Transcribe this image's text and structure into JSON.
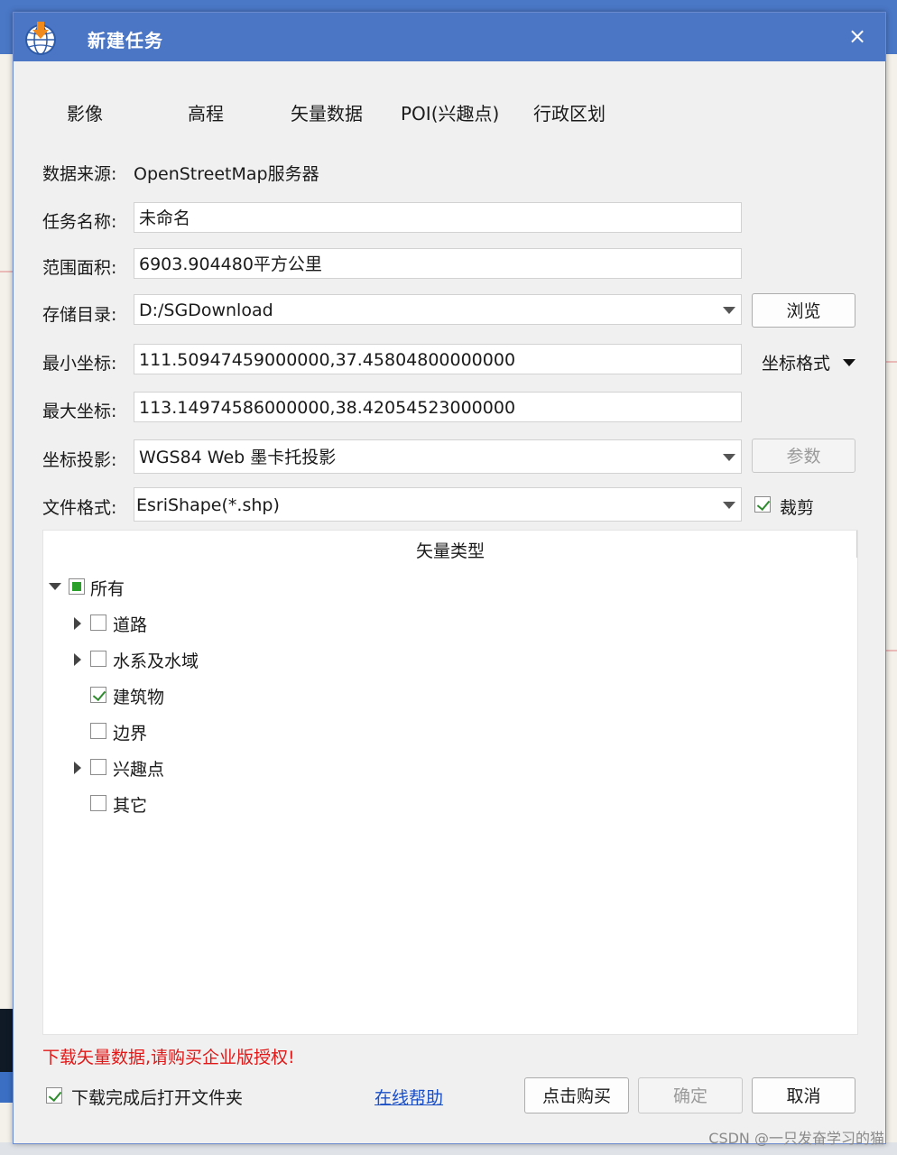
{
  "window": {
    "title": "新建任务",
    "close_label": "×"
  },
  "tabs": [
    "影像",
    "高程",
    "矢量数据",
    "POI(兴趣点)",
    "行政区划"
  ],
  "form": {
    "data_source_label": "数据来源:",
    "data_source_value": "OpenStreetMap服务器",
    "task_name_label": "任务名称:",
    "task_name_value": "未命名",
    "area_label": "范围面积:",
    "area_value": "6903.904480平方公里",
    "storage_label": "存储目录:",
    "storage_value": "D:/SGDownload",
    "browse_label": "浏览",
    "min_coord_label": "最小坐标:",
    "min_coord_value": "111.50947459000000,37.45804800000000",
    "coord_format_label": "坐标格式",
    "max_coord_label": "最大坐标:",
    "max_coord_value": "113.14974586000000,38.42054523000000",
    "projection_label": "坐标投影:",
    "projection_value": "WGS84 Web 墨卡托投影",
    "params_label": "参数",
    "file_format_label": "文件格式:",
    "file_format_value": "EsriShape(*.shp)",
    "clip_label": "裁剪",
    "clip_checked": true
  },
  "tree": {
    "header": "矢量类型",
    "root": {
      "label": "所有",
      "state": "partial",
      "expanded": true
    },
    "children": [
      {
        "label": "道路",
        "checked": false,
        "expandable": true
      },
      {
        "label": "水系及水域",
        "checked": false,
        "expandable": true
      },
      {
        "label": "建筑物",
        "checked": true,
        "expandable": false
      },
      {
        "label": "边界",
        "checked": false,
        "expandable": false
      },
      {
        "label": "兴趣点",
        "checked": false,
        "expandable": true
      },
      {
        "label": "其它",
        "checked": false,
        "expandable": false
      }
    ]
  },
  "footer": {
    "warning": "下载矢量数据,请购买企业版授权!",
    "open_folder_label": "下载完成后打开文件夹",
    "open_folder_checked": true,
    "help_link": "在线帮助",
    "buy_label": "点击购买",
    "ok_label": "确定",
    "cancel_label": "取消"
  },
  "watermark": "CSDN @一只发奋学习的猫",
  "colors": {
    "titlebar": "#4a76c5",
    "warning": "#e01818",
    "link": "#1b4fc6",
    "check": "#2e8b2e"
  }
}
